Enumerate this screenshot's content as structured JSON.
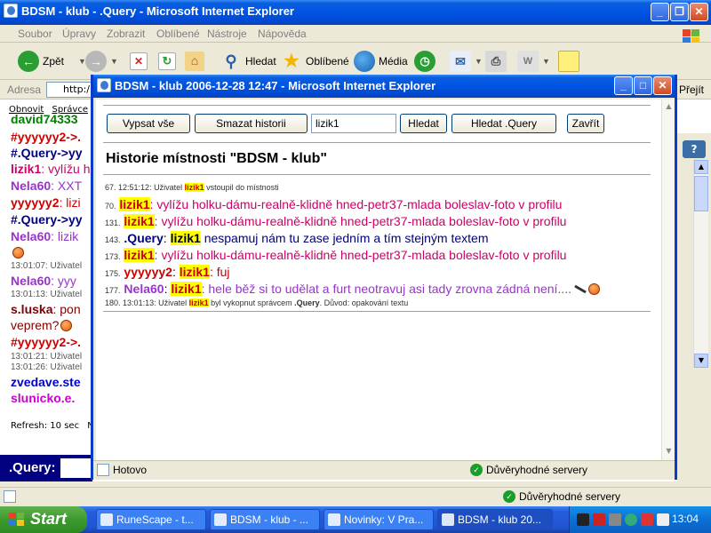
{
  "outer": {
    "title": "BDSM - klub - .Query - Microsoft Internet Explorer",
    "menu": [
      "Soubor",
      "Úpravy",
      "Zobrazit",
      "Oblíbené",
      "Nástroje",
      "Nápověda"
    ],
    "toolbar": {
      "back": "Zpět",
      "search": "Hledat",
      "favorites": "Oblíbené",
      "media": "Média"
    },
    "address_label": "Adresa",
    "address_value": "http:/",
    "go_label": "Přejít",
    "status": "Důvěryhodné servery"
  },
  "chat": {
    "toplinks": [
      "Obnovit",
      "Správce"
    ],
    "lines": [
      {
        "nick": "david74333",
        "color": "#008000"
      },
      {
        "nick": "#yyyyyy2->.",
        "color": "#cc0000"
      },
      {
        "nick": "#.Query->yy",
        "color": "#000080"
      },
      {
        "nick": "lizik1",
        "msg": ": vylížu h",
        "color": "#cc0066"
      },
      {
        "nick": "Nela60",
        "msg": ": XXT",
        "color": "#9933cc"
      },
      {
        "nick": "yyyyyy2",
        "msg": ": lizi",
        "color": "#cc0000"
      },
      {
        "nick": "#.Query->yy",
        "color": "#000080"
      },
      {
        "nick": "Nela60",
        "msg": ": lizik",
        "color": "#9933cc"
      },
      {
        "sys": "13:01:07: Uživatel"
      },
      {
        "nick": "Nela60",
        "msg": ": yyy",
        "color": "#9933cc"
      },
      {
        "sys": "13:01:13: Uživatel"
      },
      {
        "nick": "s.luska",
        "msg": ": pon",
        "color": "#800000"
      },
      {
        "msg2": "veprem?"
      },
      {
        "nick": "#yyyyyy2->.",
        "color": "#cc0000"
      },
      {
        "sys": "13:01:21: Uživatel"
      },
      {
        "sys": "13:01:26: Uživatel"
      },
      {
        "nick": "zvedave.ste",
        "color": "#0000cc"
      },
      {
        "nick": "slunicko.e.",
        "color": "#cc00cc"
      }
    ],
    "refresh": "Refresh: 10 sec",
    "refresh_suffix": "N",
    "query_label": ".Query:"
  },
  "popup": {
    "title": "BDSM - klub 2006-12-28 12:47 - Microsoft Internet Explorer",
    "buttons": {
      "show_all": "Vypsat vše",
      "clear": "Smazat historii",
      "search": "Hledat",
      "search_query": "Hledat .Query",
      "close": "Zavřít"
    },
    "search_value": "lizik1",
    "heading": "Historie místnosti \"BDSM - klub\"",
    "status_left": "Hotovo",
    "status_right": "Důvěryhodné servery",
    "history": [
      {
        "num": "67.",
        "sys_pre": "12:51:12: Uživatel ",
        "sys_hi": "lizik1",
        "sys_post": " vstoupil do místnosti"
      },
      {
        "num": "70.",
        "nick": "lizik1",
        "hi": true,
        "msg": ": vylížu holku-dámu-realně-klidně hned-petr37-mlada boleslav-foto v profilu",
        "color": "#cc0066"
      },
      {
        "num": "131.",
        "nick": "lizik1",
        "hi": true,
        "msg": ": vylížu holku-dámu-realně-klidně hned-petr37-mlada boleslav-foto v profilu",
        "color": "#cc0066"
      },
      {
        "num": "143.",
        "nick": ".Query",
        "target": "lizik1",
        "msg": " nespamuj nám tu zase jedním a tím stejným textem",
        "color": "#000080"
      },
      {
        "num": "173.",
        "nick": "lizik1",
        "hi": true,
        "msg": ": vylížu holku-dámu-realně-klidně hned-petr37-mlada boleslav-foto v profilu",
        "color": "#cc0066"
      },
      {
        "num": "175.",
        "nick": "yyyyyy2",
        "target": "lizik1",
        "msg": ": fuj",
        "color": "#cc0000"
      },
      {
        "num": "177.",
        "nick": "Nela60",
        "target": "lizik1",
        "msg": ": hele běž si to udělat a furt neotravuj asi tady zrovna zádná není....",
        "color": "#9933cc"
      },
      {
        "num": "180.",
        "sys_pre": "13:01:13: Uživatel ",
        "sys_hi": "lizik1",
        "sys_post": " byl vykopnut správcem ",
        "sys_admin": ".Query",
        "sys_tail": ". Důvod: opakování textu"
      }
    ]
  },
  "taskbar": {
    "start": "Start",
    "tasks": [
      "RuneScape - t...",
      "BDSM - klub - ...",
      "Novinky: V Pra...",
      "BDSM - klub 20..."
    ],
    "clock": "13:04"
  }
}
